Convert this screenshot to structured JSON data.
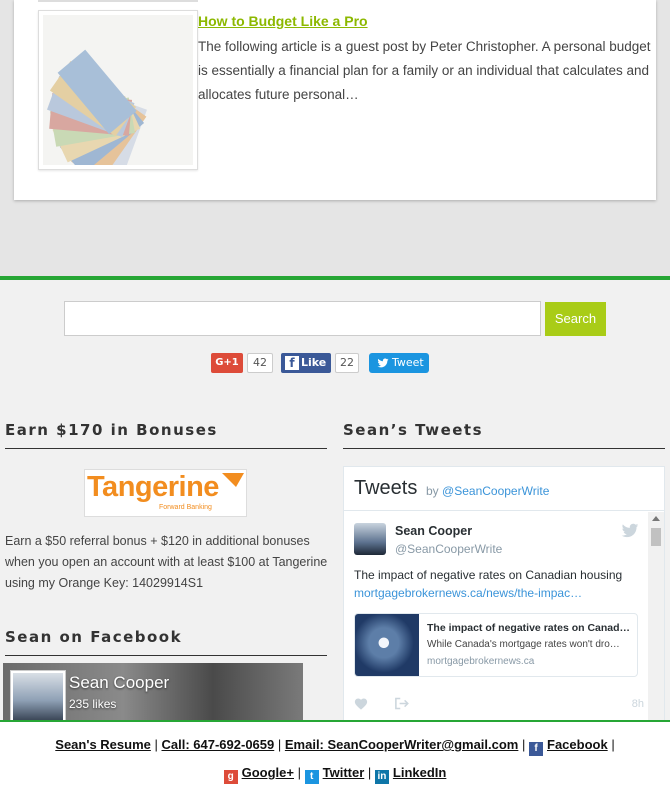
{
  "post": {
    "title": "How to Budget Like a Pro",
    "excerpt": "The following article is a guest post by Peter Christopher. A personal budget is essentially a financial plan for a family or an individual that calculates and allocates future personal…"
  },
  "search": {
    "placeholder": "",
    "button_label": "Search"
  },
  "social": {
    "gplus_label": "G+1",
    "gplus_count": "42",
    "fb_label": "Like",
    "fb_count": "22",
    "tw_label": "Tweet"
  },
  "widgets": {
    "bonuses_title": "Earn $170 in Bonuses",
    "tangerine_word": "Tangerine",
    "tangerine_tag": "Forward Banking",
    "bonuses_text": "Earn a $50 referral bonus + $120 in additional bonuses when you open an account with at least $100 at Tangerine using my Orange Key: 14029914S1",
    "facebook_title": "Sean on Facebook",
    "fb_page_name": "Sean Cooper",
    "fb_likes": "235 likes",
    "tweets_title": "Sean’s Tweets"
  },
  "tweets": {
    "header": "Tweets",
    "by_prefix": "by",
    "by_handle": "@SeanCooperWrite",
    "author_name": "Sean Cooper",
    "author_handle": "@SeanCooperWrite",
    "text": "The impact of negative rates on Canadian housing",
    "link": "mortgagebrokernews.ca/news/the-impac…",
    "card_title": "The impact of negative rates on Canadi…",
    "card_desc": "While Canada's mortgage rates won't dro…",
    "card_domain": "mortgagebrokernews.ca",
    "time": "8h"
  },
  "footer": {
    "resume": "Sean's Resume",
    "call": "Call: 647-692-0659",
    "email": "Email: SeanCooperWriter@gmail.com",
    "facebook": "Facebook",
    "googleplus": "Google+",
    "twitter": "Twitter",
    "linkedin": "LinkedIn"
  },
  "colors": {
    "accent_green": "#26a635",
    "search_button": "#a9cc17",
    "tangerine_orange": "#f28d1f",
    "twitter_blue": "#1b95e0",
    "facebook_blue": "#3b5998"
  }
}
